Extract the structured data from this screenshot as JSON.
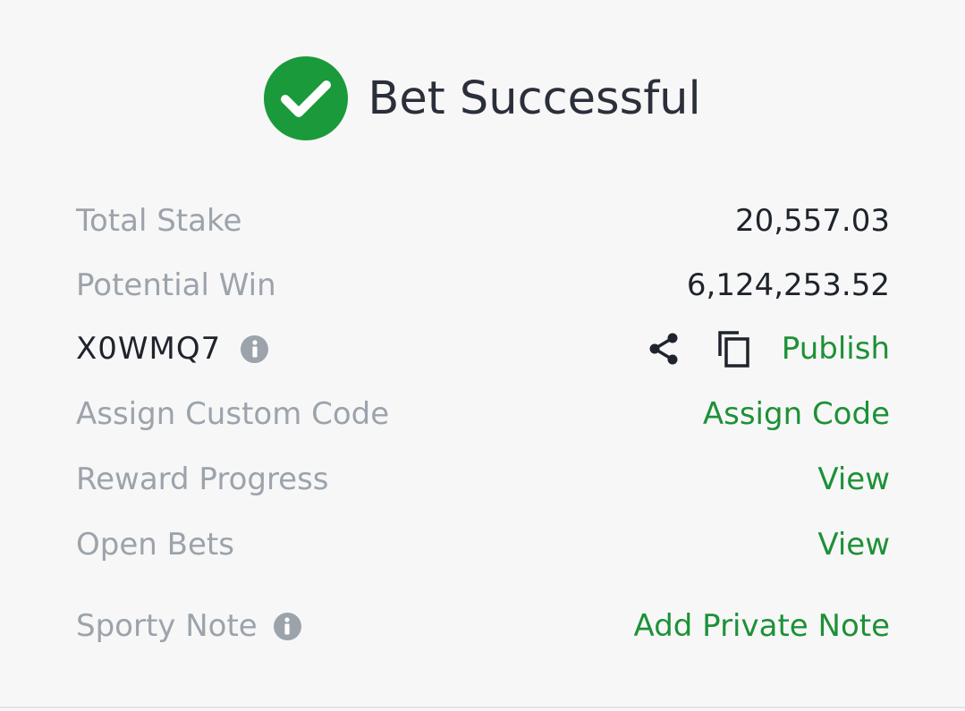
{
  "colors": {
    "success": "#1a9a3a",
    "link": "#1d9136",
    "label": "#9ca3ab",
    "value": "#1f232b",
    "background": "#f7f7f8"
  },
  "header": {
    "icon": "check-circle-icon",
    "title": "Bet Successful"
  },
  "rows": {
    "total_stake": {
      "label": "Total Stake",
      "value": "20,557.03"
    },
    "potential_win": {
      "label": "Potential Win",
      "value": "6,124,253.52"
    },
    "booking": {
      "code": "X0WMQ7",
      "info_icon": "info-icon",
      "share_icon": "share-icon",
      "copy_icon": "copy-icon",
      "publish_label": "Publish"
    },
    "custom_code": {
      "label": "Assign Custom Code",
      "action": "Assign Code"
    },
    "reward_progress": {
      "label": "Reward Progress",
      "action": "View"
    },
    "open_bets": {
      "label": "Open Bets",
      "action": "View"
    },
    "sporty_note": {
      "label": "Sporty Note",
      "info_icon": "info-icon",
      "action": "Add Private Note"
    }
  }
}
